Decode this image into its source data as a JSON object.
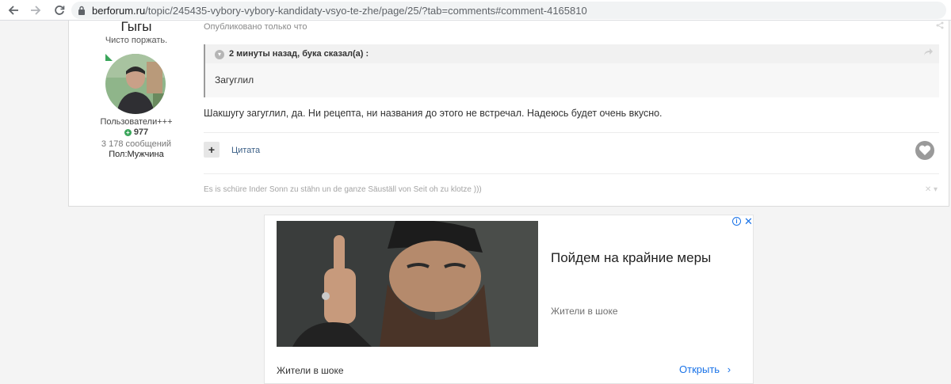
{
  "browser": {
    "url_domain": "berforum.ru",
    "url_path": "/topic/245435-vybory-vybory-kandidaty-vsyo-te-zhe/page/25/?tab=comments#comment-4165810"
  },
  "post": {
    "author": {
      "name": "Гыгы",
      "title": "Чисто поржать.",
      "group": "Пользователи+++",
      "reputation": "977",
      "posts": "3 178 сообщений",
      "gender": "Пол:Мужчина"
    },
    "published": "Опубликовано только что",
    "quote": {
      "citation": "2 минуты назад, бука сказал(а) :",
      "text": "Загуглил"
    },
    "text": "Шакшугу загуглил, да. Ни рецепта, ни названия до этого не встречал. Надеюсь будет очень вкусно.",
    "multiquote_label": "+",
    "quote_label": "Цитата",
    "signature": "Es is schüre Inder Sonn zu stähn un de ganze Säuställ von Seit oh zu klotze )))"
  },
  "ad": {
    "headline": "Пойдем на крайние меры",
    "source_right": "Жители в шоке",
    "source_bottom": "Жители в шоке",
    "open_label": "Открыть",
    "info_label": "i",
    "close_label": "✕"
  },
  "colors": {
    "accent_link": "#3b5f86",
    "ad_link": "#1a73e8",
    "online": "#3aa55a"
  }
}
